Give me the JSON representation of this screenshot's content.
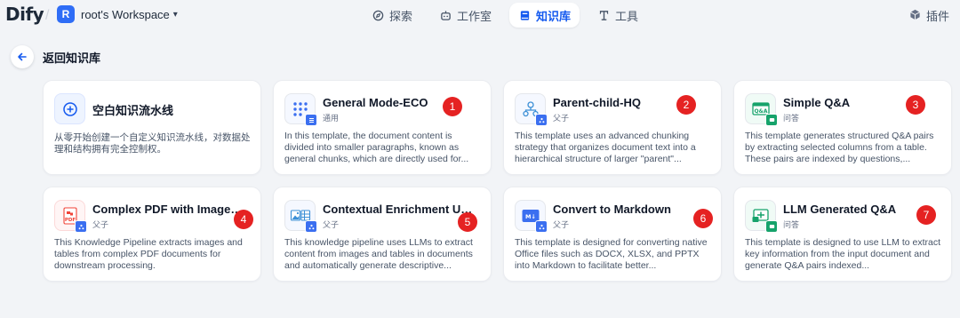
{
  "app": {
    "logo": "Dify",
    "workspace_initial": "R",
    "workspace_name": "root's Workspace"
  },
  "nav": [
    {
      "label": "探索",
      "icon": "compass-icon"
    },
    {
      "label": "工作室",
      "icon": "robot-icon"
    },
    {
      "label": "知识库",
      "icon": "book-icon",
      "active": true
    },
    {
      "label": "工具",
      "icon": "tool-icon"
    }
  ],
  "plugins_label": "插件",
  "back_label": "返回知识库",
  "blank": {
    "title": "空白知识流水线",
    "desc": "从零开始创建一个自定义知识流水线，对数据处理和结构拥有完全控制权。"
  },
  "cards": [
    {
      "title": "General Mode-ECO",
      "sub": "通用",
      "num": "1",
      "icon": "dots-grid-icon",
      "desc": "In this template, the document content is divided into smaller paragraphs, known as general chunks, which are directly used for..."
    },
    {
      "title": "Parent-child-HQ",
      "sub": "父子",
      "num": "2",
      "icon": "hierarchy-icon",
      "desc": "This template uses an advanced chunking strategy that organizes document text into a hierarchical structure of larger \"parent\"..."
    },
    {
      "title": "Simple Q&A",
      "sub": "问答",
      "num": "3",
      "icon": "qa-icon",
      "desc": "This template generates structured Q&A pairs by extracting selected columns from a table. These pairs are indexed by questions,..."
    },
    {
      "title": "Complex PDF with Images ...",
      "sub": "父子",
      "num": "4",
      "icon": "pdf-icon",
      "desc": "This Knowledge Pipeline extracts images and tables from complex PDF documents for downstream processing."
    },
    {
      "title": "Contextual Enrichment Usin...",
      "sub": "父子",
      "num": "5",
      "icon": "image-table-icon",
      "desc": "This knowledge pipeline uses LLMs to extract content from images and tables in documents and automatically generate descriptive..."
    },
    {
      "title": "Convert to Markdown",
      "sub": "父子",
      "num": "6",
      "icon": "markdown-icon",
      "desc": "This template is designed for converting native Office files such as DOCX, XLSX, and PPTX into Markdown to facilitate better..."
    },
    {
      "title": "LLM Generated Q&A",
      "sub": "问答",
      "num": "7",
      "icon": "llm-qa-icon",
      "desc": "This template is designed to use LLM to extract key information from the input document and generate Q&A pairs indexed..."
    }
  ],
  "colors": {
    "accent": "#155aef",
    "marker": "#e52222",
    "background": "#f2f4f7"
  }
}
